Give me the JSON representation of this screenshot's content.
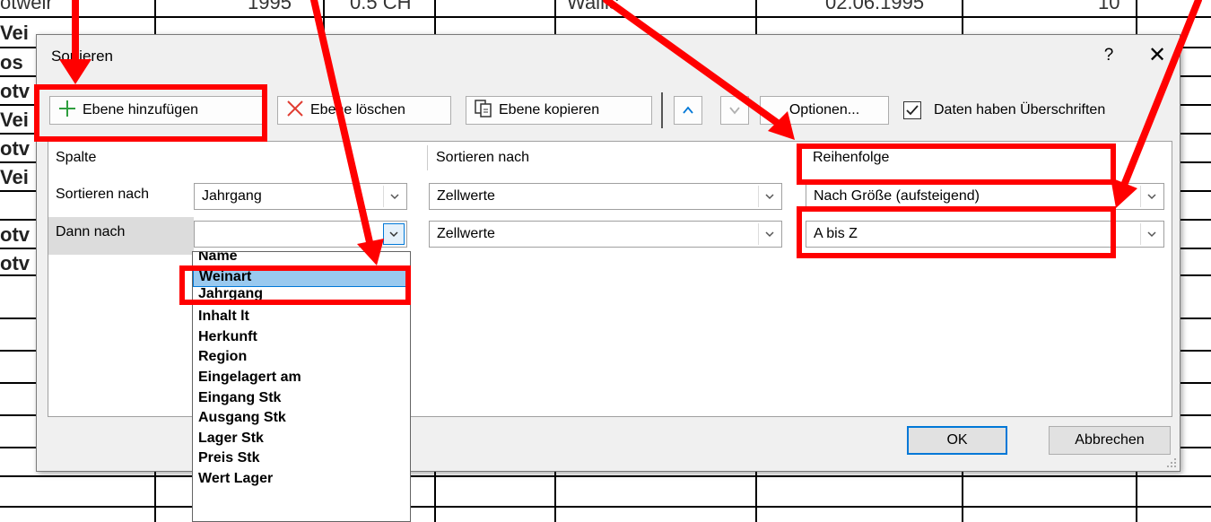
{
  "sheet": {
    "row_fragments": [
      "Vei",
      "os",
      "otv",
      "Vei",
      "otv",
      "Vei",
      "otv",
      "otv"
    ],
    "top_fragments": [
      "otweir",
      "1995",
      "0.5 CH",
      "Wallis",
      "02.06.1995",
      "10"
    ]
  },
  "dialog": {
    "title": "Sortieren",
    "help": "?",
    "close": "✕"
  },
  "toolbar": {
    "add_level": "Ebene hinzufügen",
    "delete_level": "Ebene löschen",
    "copy_level": "Ebene kopieren",
    "options": "Optionen...",
    "has_headers": "Daten haben Überschriften",
    "has_headers_checked": true
  },
  "grid": {
    "headers": {
      "column": "Spalte",
      "sort_on": "Sortieren nach",
      "order": "Reihenfolge"
    },
    "rows": [
      {
        "label": "Sortieren nach",
        "column": "Jahrgang",
        "sort_on": "Zellwerte",
        "order": "Nach Größe (aufsteigend)"
      },
      {
        "label": "Dann nach",
        "column": "",
        "sort_on": "Zellwerte",
        "order": "A bis Z"
      }
    ]
  },
  "dropdown": {
    "items": [
      "Name",
      "Weinart",
      "Jahrgang",
      "Inhalt lt",
      "Herkunft",
      "Region",
      "Eingelagert am",
      "Eingang Stk",
      "Ausgang Stk",
      "Lager Stk",
      " Preis Stk",
      " Wert Lager"
    ],
    "selected": "Weinart"
  },
  "buttons": {
    "ok": "OK",
    "cancel": "Abbrechen"
  },
  "colors": {
    "annotation": "#ff0000",
    "accent": "#0078d7",
    "add_icon": "#2e9e3e",
    "delete_icon": "#e03c31"
  }
}
